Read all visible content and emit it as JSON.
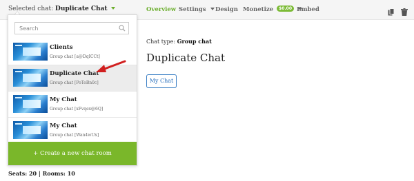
{
  "header": {
    "selected_label": "Selected chat:",
    "selected_value": "Duplicate Chat",
    "nav": {
      "overview": "Overview",
      "settings": "Settings",
      "design": "Design",
      "monetize": "Monetize",
      "monetize_badge": "$0.00",
      "embed": "Embed"
    },
    "icons": [
      "copy-icon",
      "trash-icon"
    ]
  },
  "dropdown": {
    "search_placeholder": "Search",
    "items": [
      {
        "name": "Clients",
        "sub": "Group chat [a@DqICCt]",
        "highlighted": false
      },
      {
        "name": "Duplicate Chat",
        "sub": "Group chat [PoToBn0c]",
        "highlighted": true
      },
      {
        "name": "My Chat",
        "sub": "Group chat [xFvqex@6Q]",
        "highlighted": false
      },
      {
        "name": "My Chat",
        "sub": "Group chat [Wan4wUx]",
        "highlighted": false
      }
    ],
    "create_label": "+ Create a new chat room"
  },
  "footer": {
    "seats": "Seats: 20 | Rooms: 10"
  },
  "main": {
    "chat_type_label": "Chat type:",
    "chat_type_value": "Group chat",
    "title": "Duplicate Chat",
    "button": "My Chat"
  },
  "colors": {
    "accent_green": "#7ab72a",
    "link_blue": "#2f74bf",
    "arrow_red": "#d11f1f"
  }
}
